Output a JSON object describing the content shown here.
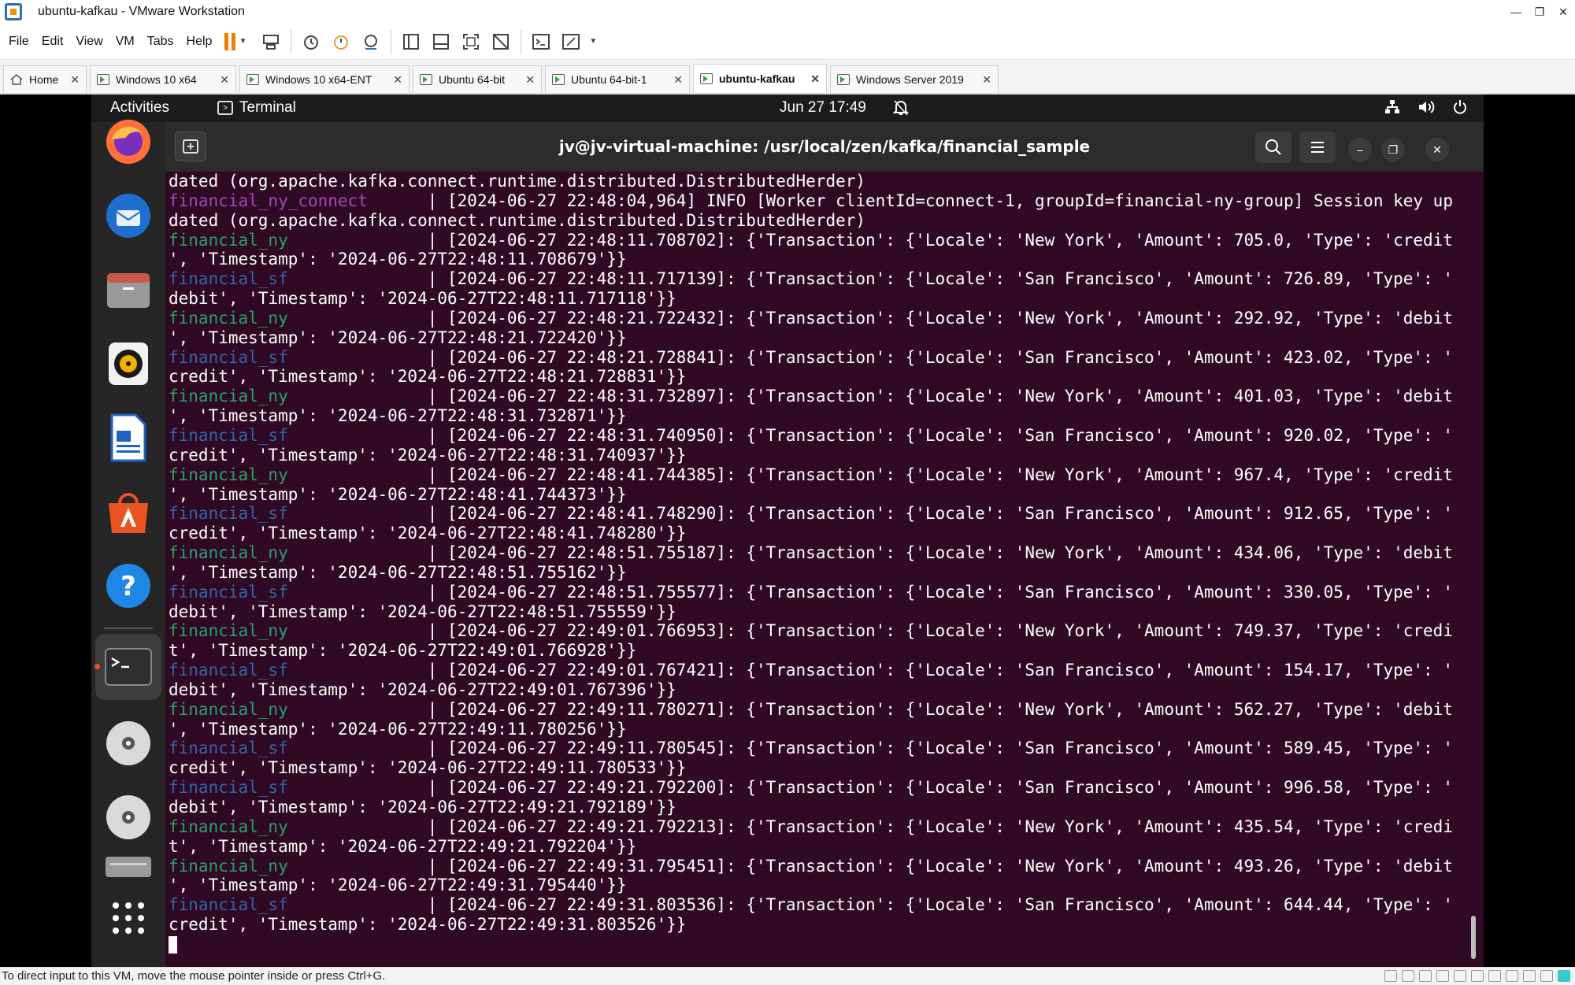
{
  "window": {
    "title": "ubuntu-kafkau - VMware Workstation"
  },
  "menu": [
    "File",
    "Edit",
    "View",
    "VM",
    "Tabs",
    "Help"
  ],
  "tabs": [
    {
      "label": "Home",
      "active": false,
      "home": true
    },
    {
      "label": "Windows 10 x64",
      "active": false
    },
    {
      "label": "Windows 10 x64-ENT",
      "active": false
    },
    {
      "label": "Ubuntu 64-bit",
      "active": false
    },
    {
      "label": "Ubuntu 64-bit-1",
      "active": false
    },
    {
      "label": "ubuntu-kafkau",
      "active": true
    },
    {
      "label": "Windows Server 2019",
      "active": false
    }
  ],
  "ubuntu": {
    "activities": "Activities",
    "app_name": "Terminal",
    "clock": "Jun 27  17:49"
  },
  "terminal": {
    "title": "jv@jv-virtual-machine: /usr/local/zen/kafka/financial_sample",
    "lines": [
      {
        "svc": "",
        "cls": "",
        "text": "dated (org.apache.kafka.connect.runtime.distributed.DistributedHerder)"
      },
      {
        "svc": "financial_ny_connect",
        "cls": "c-conn",
        "text": "| [2024-06-27 22:48:04,964] INFO [Worker clientId=connect-1, groupId=financial-ny-group] Session key up"
      },
      {
        "svc": "",
        "cls": "",
        "text": "dated (org.apache.kafka.connect.runtime.distributed.DistributedHerder)"
      },
      {
        "svc": "financial_ny",
        "cls": "c-ny",
        "text": "| [2024-06-27 22:48:11.708702]: {'Transaction': {'Locale': 'New York', 'Amount': 705.0, 'Type': 'credit"
      },
      {
        "svc": "",
        "cls": "",
        "text": "', 'Timestamp': '2024-06-27T22:48:11.708679'}}"
      },
      {
        "svc": "financial_sf",
        "cls": "c-sf",
        "text": "| [2024-06-27 22:48:11.717139]: {'Transaction': {'Locale': 'San Francisco', 'Amount': 726.89, 'Type': '"
      },
      {
        "svc": "",
        "cls": "",
        "text": "debit', 'Timestamp': '2024-06-27T22:48:11.717118'}}"
      },
      {
        "svc": "financial_ny",
        "cls": "c-ny",
        "text": "| [2024-06-27 22:48:21.722432]: {'Transaction': {'Locale': 'New York', 'Amount': 292.92, 'Type': 'debit"
      },
      {
        "svc": "",
        "cls": "",
        "text": "', 'Timestamp': '2024-06-27T22:48:21.722420'}}"
      },
      {
        "svc": "financial_sf",
        "cls": "c-sf",
        "text": "| [2024-06-27 22:48:21.728841]: {'Transaction': {'Locale': 'San Francisco', 'Amount': 423.02, 'Type': '"
      },
      {
        "svc": "",
        "cls": "",
        "text": "credit', 'Timestamp': '2024-06-27T22:48:21.728831'}}"
      },
      {
        "svc": "financial_ny",
        "cls": "c-ny",
        "text": "| [2024-06-27 22:48:31.732897]: {'Transaction': {'Locale': 'New York', 'Amount': 401.03, 'Type': 'debit"
      },
      {
        "svc": "",
        "cls": "",
        "text": "', 'Timestamp': '2024-06-27T22:48:31.732871'}}"
      },
      {
        "svc": "financial_sf",
        "cls": "c-sf",
        "text": "| [2024-06-27 22:48:31.740950]: {'Transaction': {'Locale': 'San Francisco', 'Amount': 920.02, 'Type': '"
      },
      {
        "svc": "",
        "cls": "",
        "text": "credit', 'Timestamp': '2024-06-27T22:48:31.740937'}}"
      },
      {
        "svc": "financial_ny",
        "cls": "c-ny",
        "text": "| [2024-06-27 22:48:41.744385]: {'Transaction': {'Locale': 'New York', 'Amount': 967.4, 'Type': 'credit"
      },
      {
        "svc": "",
        "cls": "",
        "text": "', 'Timestamp': '2024-06-27T22:48:41.744373'}}"
      },
      {
        "svc": "financial_sf",
        "cls": "c-sf",
        "text": "| [2024-06-27 22:48:41.748290]: {'Transaction': {'Locale': 'San Francisco', 'Amount': 912.65, 'Type': '"
      },
      {
        "svc": "",
        "cls": "",
        "text": "credit', 'Timestamp': '2024-06-27T22:48:41.748280'}}"
      },
      {
        "svc": "financial_ny",
        "cls": "c-ny",
        "text": "| [2024-06-27 22:48:51.755187]: {'Transaction': {'Locale': 'New York', 'Amount': 434.06, 'Type': 'debit"
      },
      {
        "svc": "",
        "cls": "",
        "text": "', 'Timestamp': '2024-06-27T22:48:51.755162'}}"
      },
      {
        "svc": "financial_sf",
        "cls": "c-sf",
        "text": "| [2024-06-27 22:48:51.755577]: {'Transaction': {'Locale': 'San Francisco', 'Amount': 330.05, 'Type': '"
      },
      {
        "svc": "",
        "cls": "",
        "text": "debit', 'Timestamp': '2024-06-27T22:48:51.755559'}}"
      },
      {
        "svc": "financial_ny",
        "cls": "c-ny",
        "text": "| [2024-06-27 22:49:01.766953]: {'Transaction': {'Locale': 'New York', 'Amount': 749.37, 'Type': 'credi"
      },
      {
        "svc": "",
        "cls": "",
        "text": "t', 'Timestamp': '2024-06-27T22:49:01.766928'}}"
      },
      {
        "svc": "financial_sf",
        "cls": "c-sf",
        "text": "| [2024-06-27 22:49:01.767421]: {'Transaction': {'Locale': 'San Francisco', 'Amount': 154.17, 'Type': '"
      },
      {
        "svc": "",
        "cls": "",
        "text": "debit', 'Timestamp': '2024-06-27T22:49:01.767396'}}"
      },
      {
        "svc": "financial_ny",
        "cls": "c-ny",
        "text": "| [2024-06-27 22:49:11.780271]: {'Transaction': {'Locale': 'New York', 'Amount': 562.27, 'Type': 'debit"
      },
      {
        "svc": "",
        "cls": "",
        "text": "', 'Timestamp': '2024-06-27T22:49:11.780256'}}"
      },
      {
        "svc": "financial_sf",
        "cls": "c-sf",
        "text": "| [2024-06-27 22:49:11.780545]: {'Transaction': {'Locale': 'San Francisco', 'Amount': 589.45, 'Type': '"
      },
      {
        "svc": "",
        "cls": "",
        "text": "credit', 'Timestamp': '2024-06-27T22:49:11.780533'}}"
      },
      {
        "svc": "financial_sf",
        "cls": "c-sf",
        "text": "| [2024-06-27 22:49:21.792200]: {'Transaction': {'Locale': 'San Francisco', 'Amount': 996.58, 'Type': '"
      },
      {
        "svc": "",
        "cls": "",
        "text": "debit', 'Timestamp': '2024-06-27T22:49:21.792189'}}"
      },
      {
        "svc": "financial_ny",
        "cls": "c-ny",
        "text": "| [2024-06-27 22:49:21.792213]: {'Transaction': {'Locale': 'New York', 'Amount': 435.54, 'Type': 'credi"
      },
      {
        "svc": "",
        "cls": "",
        "text": "t', 'Timestamp': '2024-06-27T22:49:21.792204'}}"
      },
      {
        "svc": "financial_ny",
        "cls": "c-ny",
        "text": "| [2024-06-27 22:49:31.795451]: {'Transaction': {'Locale': 'New York', 'Amount': 493.26, 'Type': 'debit"
      },
      {
        "svc": "",
        "cls": "",
        "text": "', 'Timestamp': '2024-06-27T22:49:31.795440'}}"
      },
      {
        "svc": "financial_sf",
        "cls": "c-sf",
        "text": "| [2024-06-27 22:49:31.803536]: {'Transaction': {'Locale': 'San Francisco', 'Amount': 644.44, 'Type': '"
      },
      {
        "svc": "",
        "cls": "",
        "text": "credit', 'Timestamp': '2024-06-27T22:49:31.803526'}}"
      }
    ]
  },
  "status_bar": {
    "message": "To direct input to this VM, move the mouse pointer inside or press Ctrl+G."
  },
  "colors": {
    "terminal_bg": "#300a24",
    "ny_service": "#26a269",
    "sf_service": "#3465a4",
    "connect_service": "#a347ba",
    "ubuntu_accent": "#e95420",
    "vmware_pause": "#f07d00"
  },
  "icons": {
    "dock": [
      "firefox-icon",
      "thunderbird-icon",
      "files-icon",
      "rhythmbox-icon",
      "writer-icon",
      "software-icon",
      "help-icon",
      "terminal-icon",
      "disc-icon",
      "disc-icon",
      "drive-icon",
      "apps-grid-icon"
    ]
  }
}
